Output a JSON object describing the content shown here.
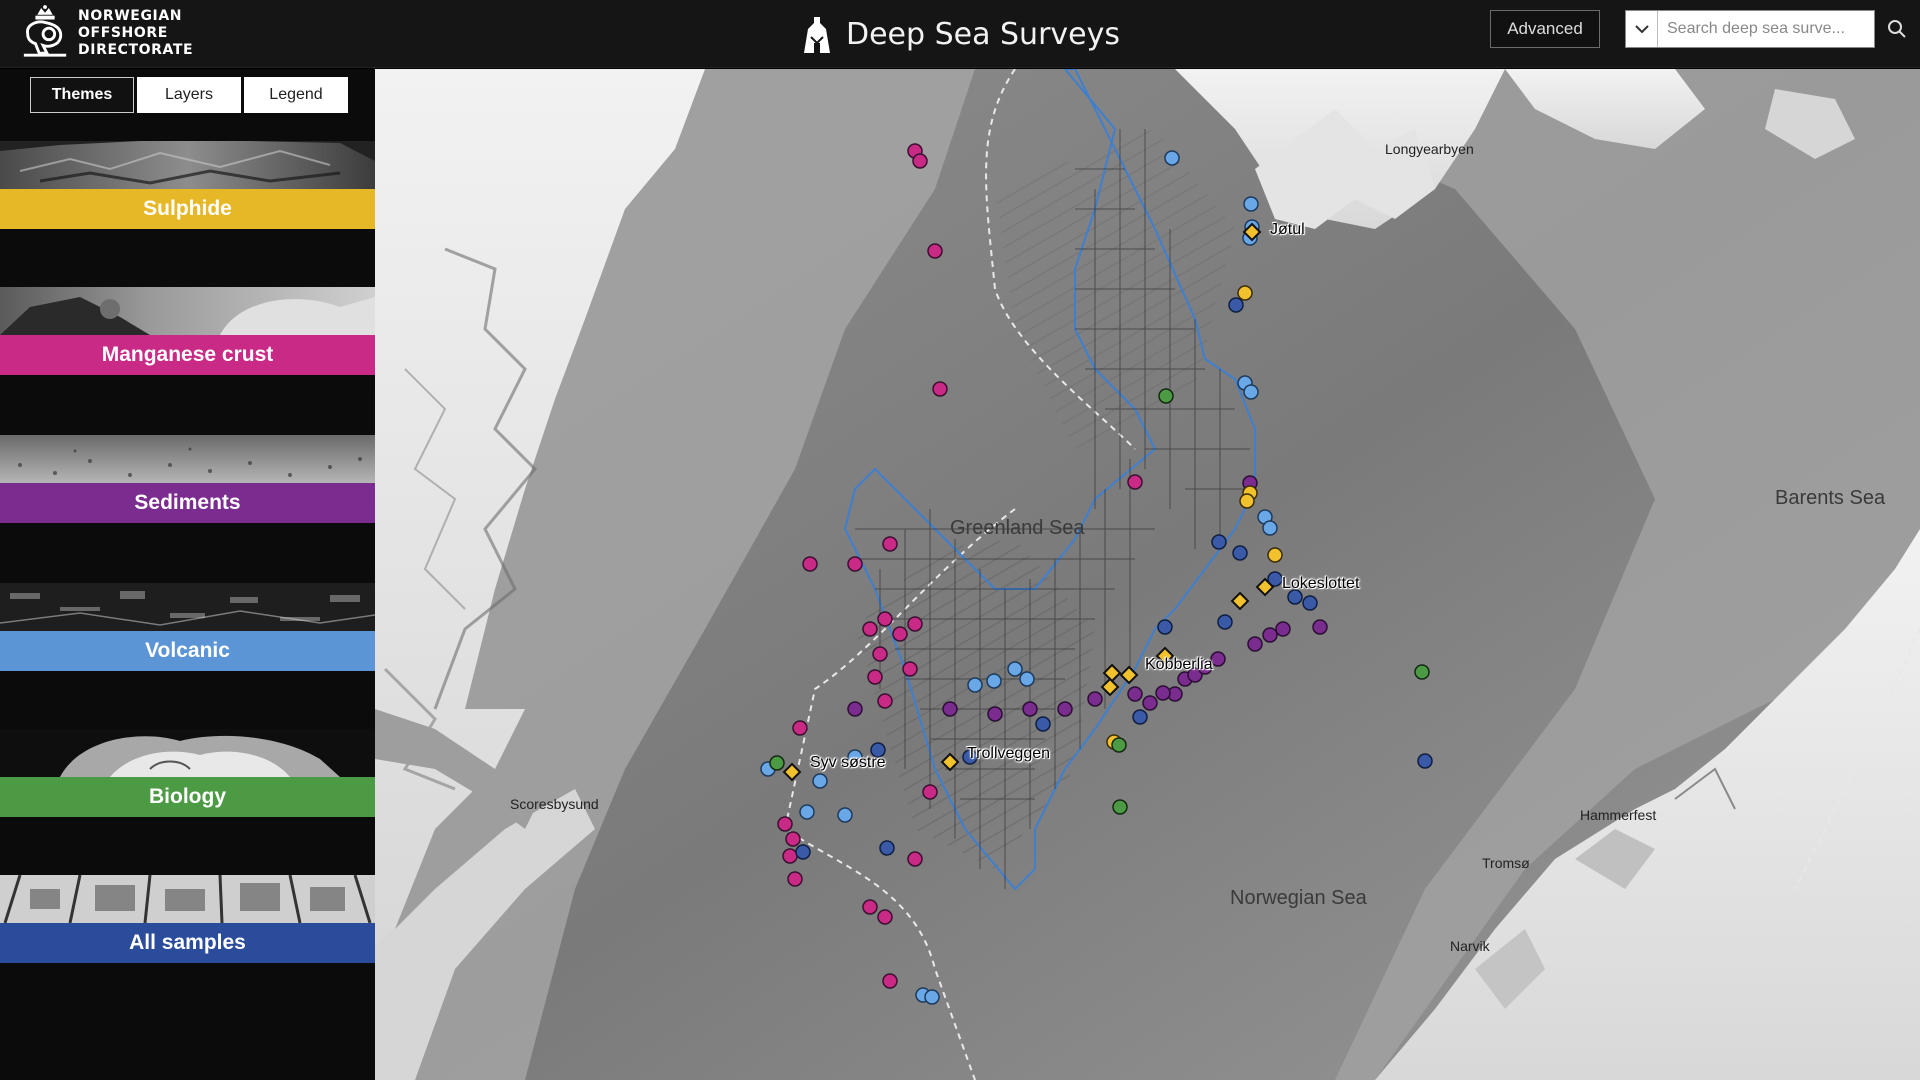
{
  "header": {
    "org_line1": "NORWEGIAN OFFSHORE",
    "org_line2": "DIRECTORATE",
    "app_title": "Deep Sea Surveys",
    "advanced_label": "Advanced",
    "search_placeholder": "Search deep sea surve..."
  },
  "sidebar": {
    "tabs": [
      {
        "label": "Themes",
        "active": true
      },
      {
        "label": "Layers",
        "active": false
      },
      {
        "label": "Legend",
        "active": false
      }
    ],
    "themes": [
      {
        "label": "Sulphide",
        "color": "#e6b827"
      },
      {
        "label": "Manganese crust",
        "color": "#c92a86"
      },
      {
        "label": "Sediments",
        "color": "#7b2c8f"
      },
      {
        "label": "Volcanic",
        "color": "#5b95d6"
      },
      {
        "label": "Biology",
        "color": "#4d9a45"
      },
      {
        "label": "All samples",
        "color": "#2b4c9b"
      }
    ]
  },
  "map": {
    "place_labels": {
      "longyearbyen": "Longyearbyen",
      "barents_sea": "Barents Sea",
      "greenland_sea": "Greenland Sea",
      "scoresbysund": "Scoresbysund",
      "hammerfest": "Hammerfest",
      "tromso": "Tromsø",
      "narvik": "Narvik",
      "norwegian_sea": "Norwegian Sea"
    },
    "site_labels": {
      "jotul": "Jøtul",
      "lokeslottet": "Lokeslottet",
      "kobberlia": "Kobberlia",
      "trollveggen": "Trollveggen",
      "syv_sostre": "Syv søstre"
    },
    "marker_colors": {
      "manganese": "#c92a86",
      "volcanic": "#6aa7e6",
      "all_samples": "#3a5aa8",
      "sulphide": "#f2c22e",
      "sediments": "#7b2c8f",
      "biology": "#4d9a45",
      "boundary": "#3f7fd0"
    }
  }
}
